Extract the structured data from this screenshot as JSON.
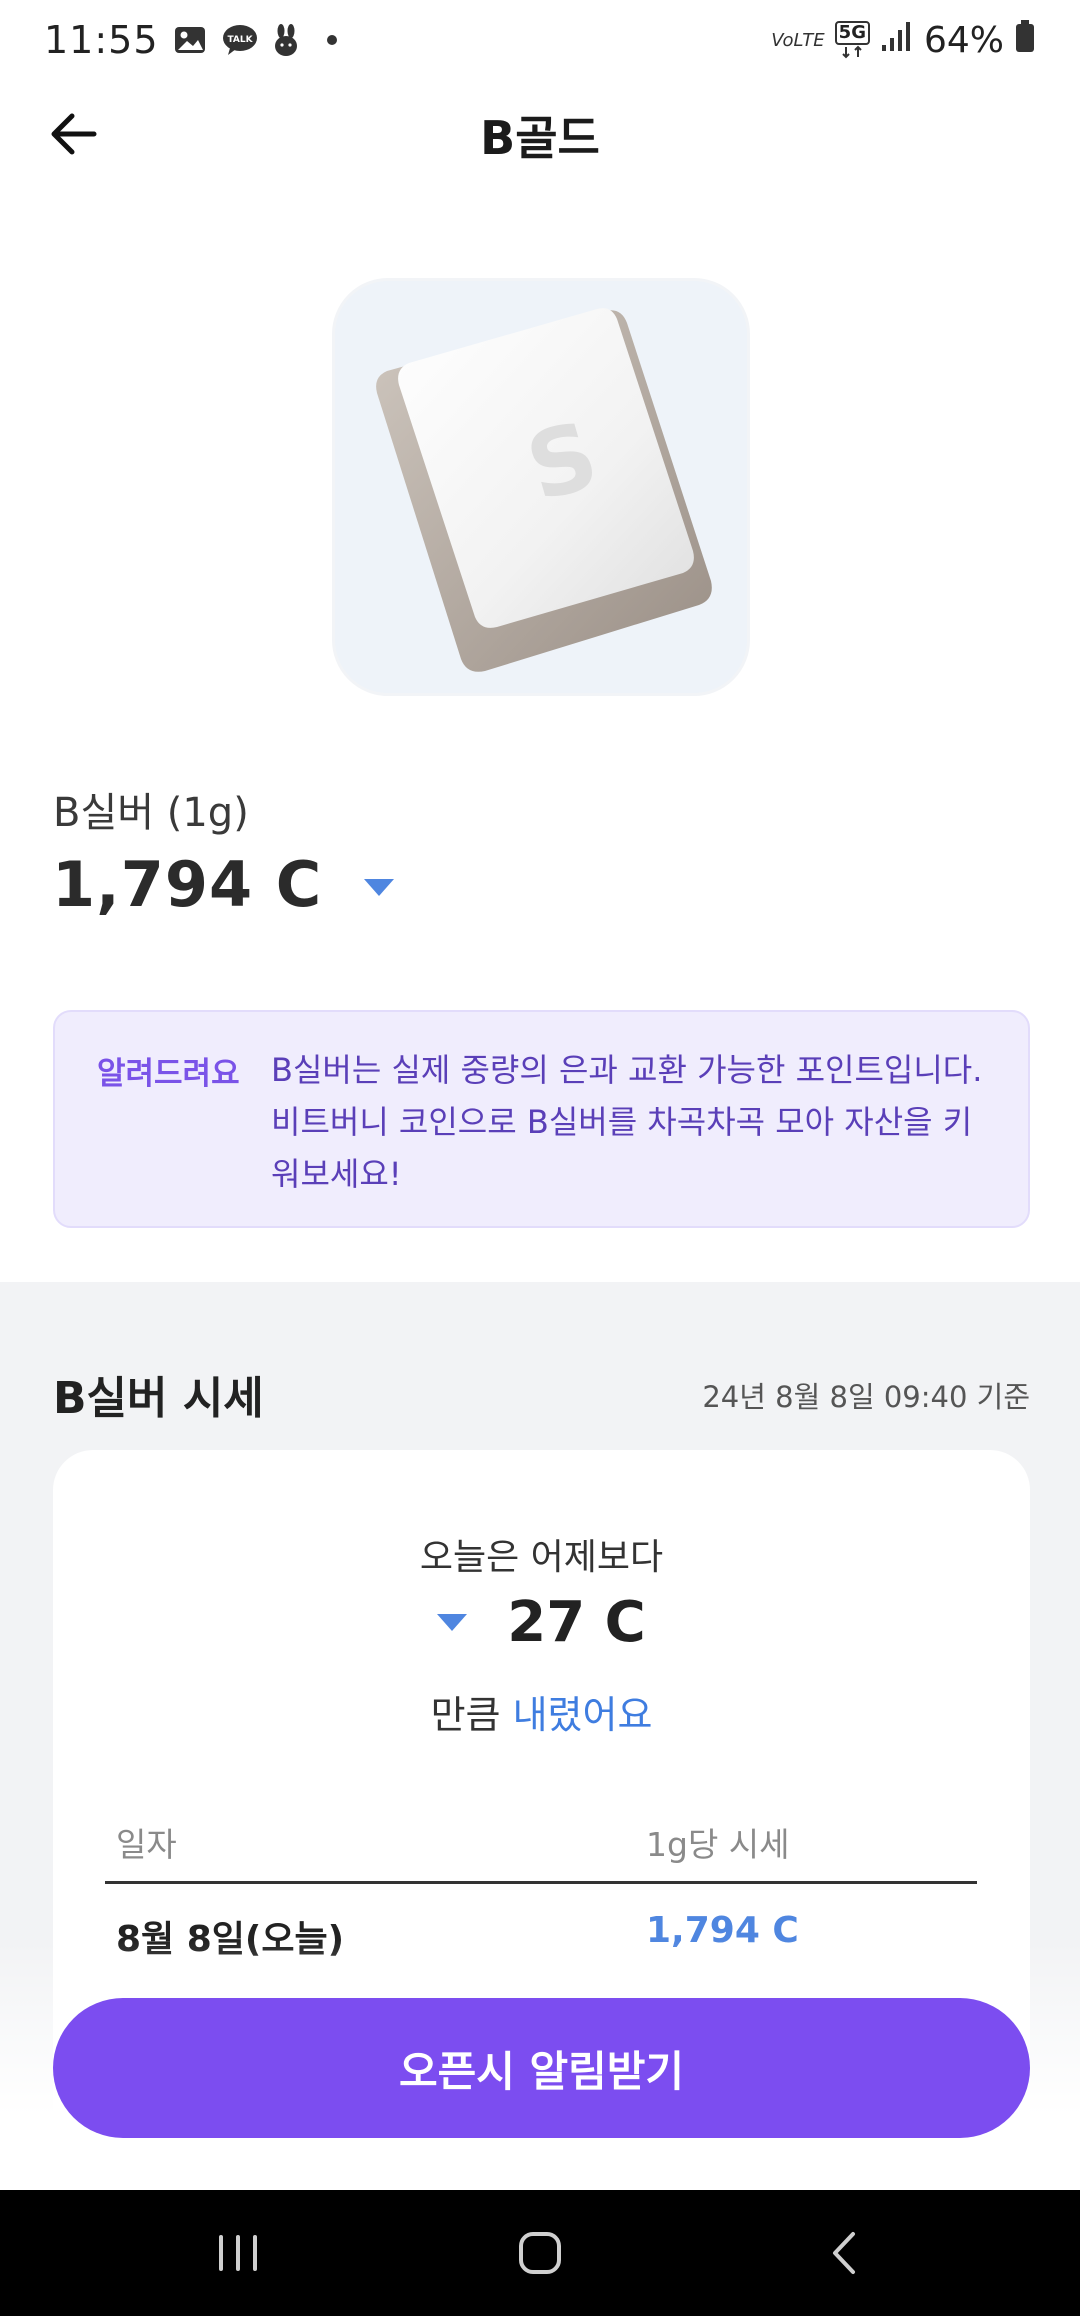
{
  "status_bar": {
    "time": "11:55",
    "battery": "64%",
    "left_icons": [
      "gallery-icon",
      "kakaotalk-icon",
      "bunny-app-icon",
      "dot-icon"
    ],
    "right_icons": [
      "volte-icon",
      "5g-icon",
      "signal-icon",
      "battery-icon"
    ],
    "volte_label": "VoLTE",
    "network_label": "5G"
  },
  "header": {
    "title": "B골드",
    "back_icon": "arrow-left-icon"
  },
  "product": {
    "image_icon": "silver-bar-icon",
    "image_letter": "S",
    "name": "B실버 (1g)",
    "price": "1,794 C",
    "trend": "down",
    "trend_color": "#4f86e0"
  },
  "notice": {
    "tag": "알려드려요",
    "text": "B실버는 실제 중량의 은과 교환 가능한 포인트입니다. 비트버니 코인으로 B실버를 차곡차곡 모아 자산을 키워보세요!"
  },
  "market": {
    "title": "B실버 시세",
    "as_of": "24년 8월 8일 09:40 기준",
    "compare_label": "오늘은 어제보다",
    "change_value": "27 C",
    "change_suffix_prefix": "만큼",
    "change_suffix_word": "내렸어요",
    "table": {
      "headers": [
        "일자",
        "1g당 시세"
      ],
      "rows": [
        {
          "date": "8월 8일(오늘)",
          "price": "1,794 C"
        }
      ]
    }
  },
  "cta": {
    "label": "오픈시 알림받기",
    "color": "#7c4df0"
  },
  "nav": {
    "icons": [
      "recents-icon",
      "home-icon",
      "back-icon"
    ]
  },
  "colors": {
    "accent_purple": "#7c4df0",
    "down_blue": "#4f86e0",
    "notice_bg": "#f0edfd"
  }
}
